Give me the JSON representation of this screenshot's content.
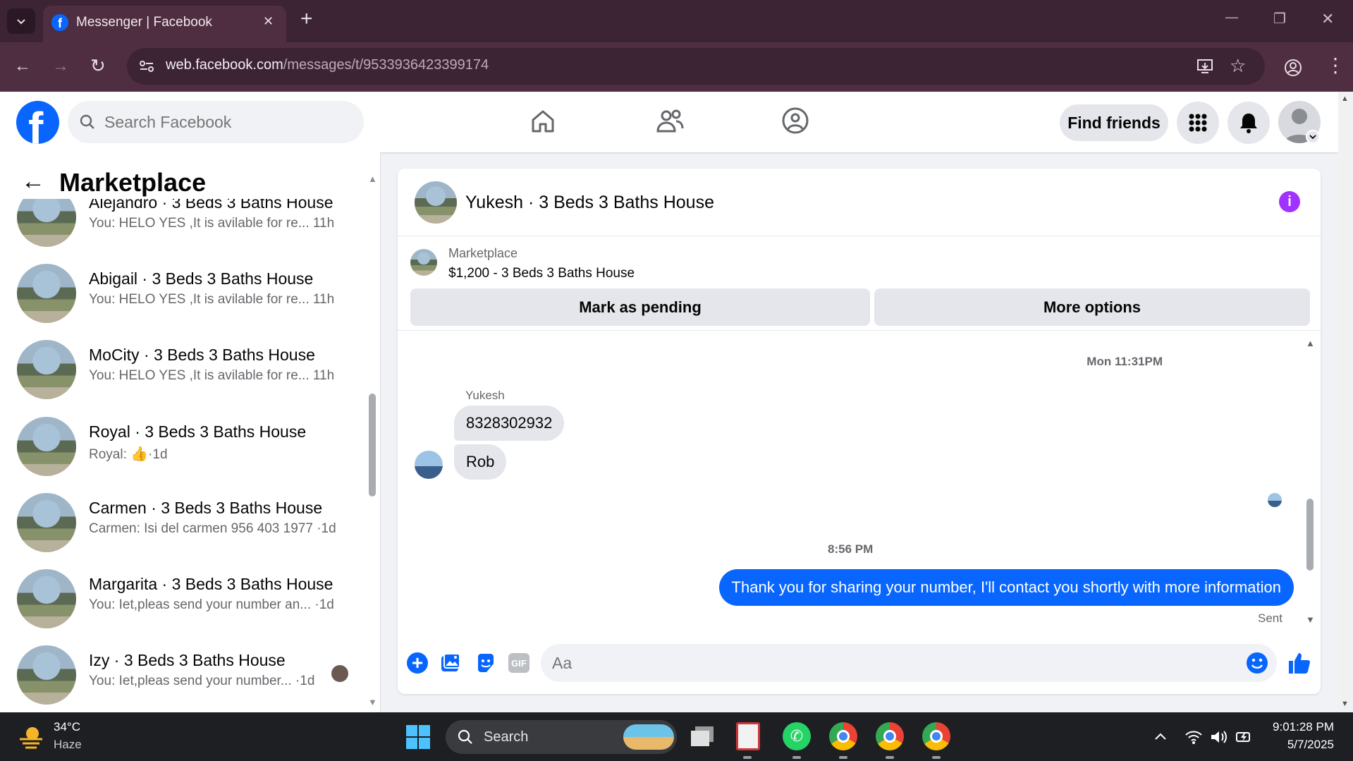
{
  "browser": {
    "tab_title": "Messenger | Facebook",
    "url_host": "web.facebook.com",
    "url_path": "/messages/t/9533936423399174",
    "new_tab": "+",
    "close_tab": "✕",
    "minimize": "—",
    "restore": "❐",
    "close_window": "✕"
  },
  "header": {
    "search_placeholder": "Search Facebook",
    "find_friends": "Find friends"
  },
  "sidebar": {
    "title": "Marketplace",
    "conversations": [
      {
        "name": "Alejandro · 3 Beds 3 Baths House",
        "preview": "You: HELO YES ,It is avilable for re...",
        "time": "11h"
      },
      {
        "name": "Abigail · 3 Beds 3 Baths House",
        "preview": "You: HELO YES ,It is avilable for re...",
        "time": "11h"
      },
      {
        "name": "MoCity · 3 Beds 3 Baths House",
        "preview": "You: HELO YES ,It is avilable for re...",
        "time": "11h"
      },
      {
        "name": "Royal · 3 Beds 3 Baths House",
        "preview": "Royal:",
        "time": "1d"
      },
      {
        "name": "Carmen · 3 Beds 3 Baths House",
        "preview": "Carmen: Isi del carmen 956 403 1977",
        "time": "1d"
      },
      {
        "name": "Margarita · 3 Beds 3 Baths House",
        "preview": "You: Iet,pleas send your number an...",
        "time": "1d"
      },
      {
        "name": "Izy · 3 Beds 3 Baths House",
        "preview": "You: Iet,pleas send your number...",
        "time": "1d"
      }
    ]
  },
  "chat": {
    "title": "Yukesh · 3 Beds 3 Baths House",
    "listing_label": "Marketplace",
    "listing_price": "$1,200 - 3 Beds 3 Baths House",
    "mark_pending": "Mark as pending",
    "more_options": "More options",
    "timestamp1": "Mon 11:31PM",
    "sender": "Yukesh",
    "msg1": "8328302932",
    "msg2": "Rob",
    "timestamp2": "8:56 PM",
    "my_msg": "Thank you for sharing your number, I'll contact you shortly with more information",
    "status": "Sent",
    "input_placeholder": "Aa",
    "gif": "GIF"
  },
  "taskbar": {
    "temp": "34°C",
    "weather": "Haze",
    "search": "Search",
    "time": "9:01:28 PM",
    "date": "5/7/2025"
  },
  "colors": {
    "fb_blue": "#0866ff",
    "messenger_purple": "#a033ff",
    "chrome_bg": "#3c2434"
  }
}
